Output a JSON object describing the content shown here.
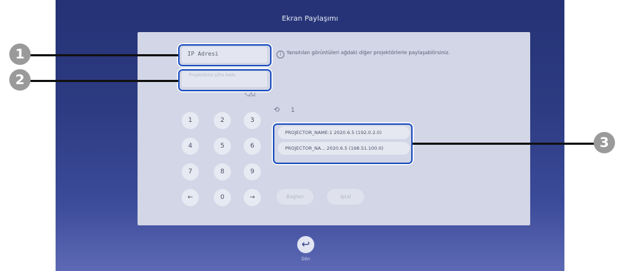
{
  "screen": {
    "title": "Ekran Paylaşımı",
    "ip_field": "IP Adresi",
    "password_field": "Projektörün şifre kodu",
    "info": "Yansıtılan görüntüleri ağdaki diğer projektörlerle paylaşabilirsiniz.",
    "keypad": [
      "1",
      "2",
      "3",
      "4",
      "5",
      "6",
      "7",
      "8",
      "9",
      "←",
      "0",
      "→"
    ],
    "history_count": "1",
    "projectors": [
      "PROJECTOR_NAME:1   2020.6.5 (192.0.2.0)",
      "PROJECTOR_NA...   2020.6.5 (198.51.100.0)"
    ],
    "connect": "Bağlan",
    "cancel": "İptal",
    "back": "Dön"
  },
  "callouts": [
    "1",
    "2",
    "3"
  ],
  "icons": [
    "info-icon",
    "backspace-icon",
    "history-icon",
    "back-arrow-icon"
  ],
  "colors": {
    "highlight": "#1a4dbf",
    "screen_bg": "#2d3b82",
    "panel_bg": "#d2d6e6",
    "callout_bg": "#9a9a9a"
  }
}
